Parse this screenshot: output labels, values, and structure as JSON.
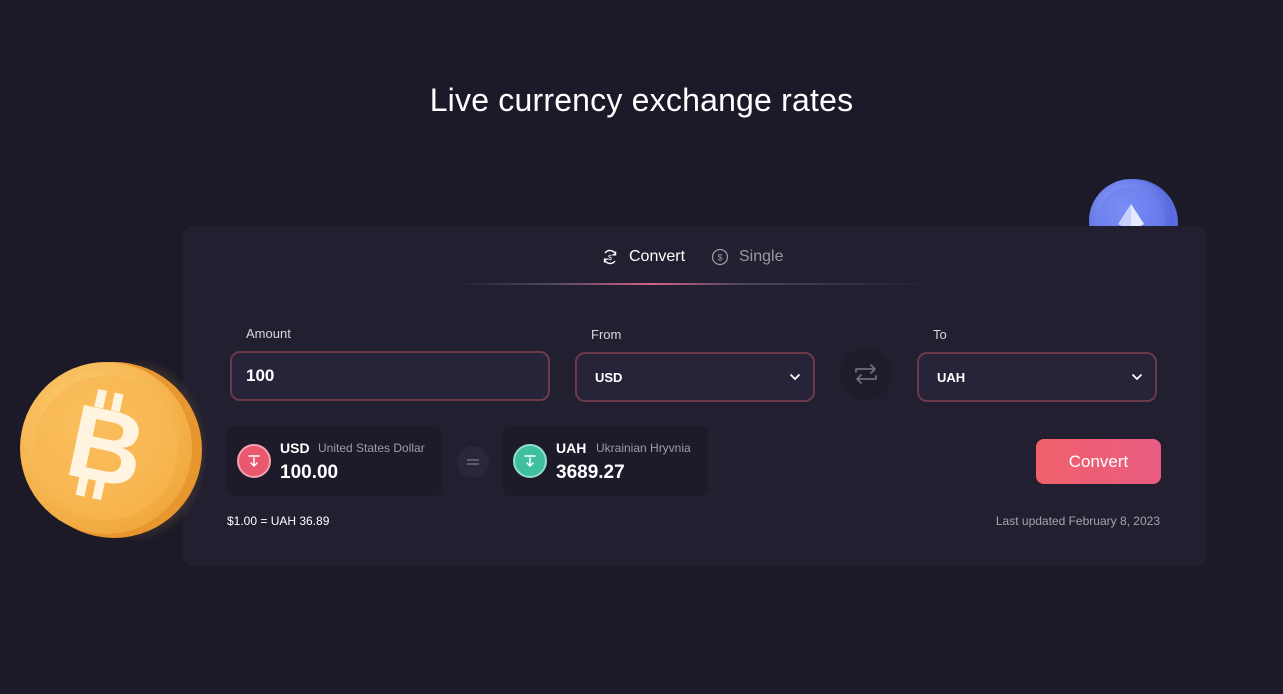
{
  "page": {
    "title": "Live currency exchange rates"
  },
  "tabs": [
    {
      "label": "Convert",
      "icon": "convert-cycle-icon",
      "active": true
    },
    {
      "label": "Single",
      "icon": "dollar-circle-icon",
      "active": false
    }
  ],
  "form": {
    "amount_label": "Amount",
    "amount_value": "100",
    "from_label": "From",
    "from_value": "USD",
    "to_label": "To",
    "to_value": "UAH"
  },
  "result": {
    "from": {
      "code": "USD",
      "name": "United States Dollar",
      "amount": "100.00",
      "color": "#e8596f"
    },
    "to": {
      "code": "UAH",
      "name": "Ukrainian Hryvnia",
      "amount": "3689.27",
      "color": "#3fbf9e"
    }
  },
  "convert_button": "Convert",
  "rate_text": "$1.00 = UAH 36.89",
  "last_updated": "Last updated February 8, 2023",
  "colors": {
    "background": "#1c1a28",
    "card": "#221f30",
    "accent": "#ee5f72",
    "field_border": "#6b3a4a"
  }
}
